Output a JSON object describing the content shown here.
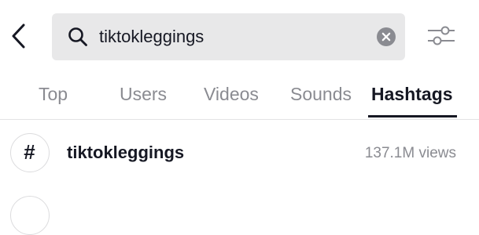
{
  "header": {
    "back_icon": "chevron-left-icon",
    "filter_icon": "sliders-icon"
  },
  "search": {
    "value": "tiktokleggings",
    "search_icon": "search-icon",
    "clear_icon": "clear-icon"
  },
  "tabs": [
    {
      "label": "Top",
      "active": false
    },
    {
      "label": "Users",
      "active": false
    },
    {
      "label": "Videos",
      "active": false
    },
    {
      "label": "Sounds",
      "active": false
    },
    {
      "label": "Hashtags",
      "active": true
    }
  ],
  "results": [
    {
      "icon": "#",
      "name": "tiktokleggings",
      "views": "137.1M views"
    }
  ],
  "colors": {
    "search_bg": "#e8e8e9",
    "text_primary": "#161823",
    "text_secondary": "#8a8b91"
  }
}
